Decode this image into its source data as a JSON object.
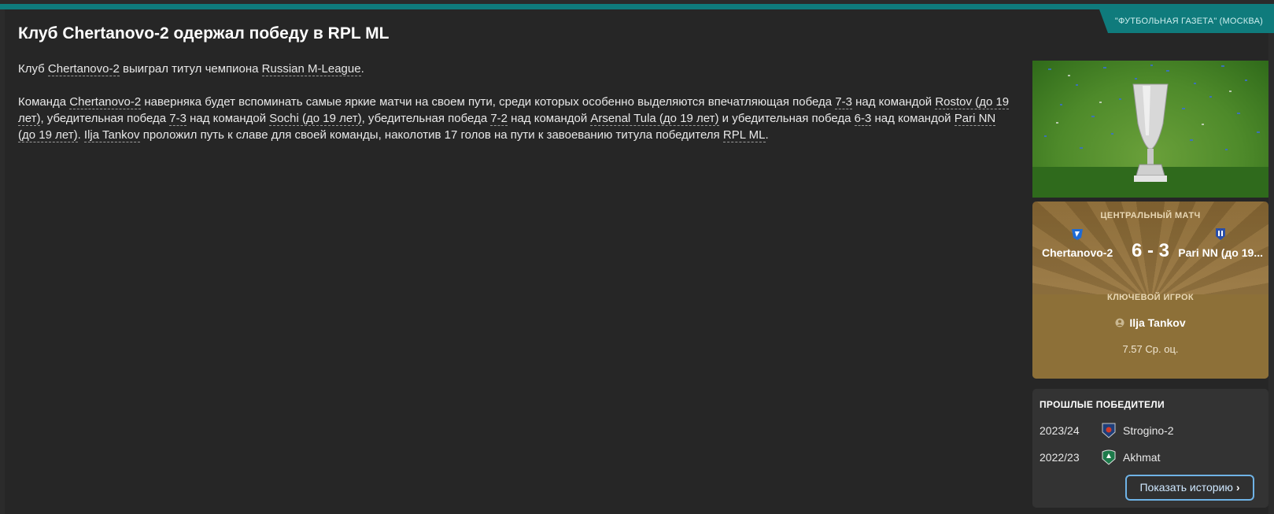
{
  "source": "\"ФУТБОЛЬНАЯ ГАЗЕТА\" (МОСКВА)",
  "headline": "Клуб Chertanovo-2 одержал победу в RPL ML",
  "article": {
    "p1": {
      "t0": "Клуб ",
      "club": "Chertanovo-2",
      "t1": " выиграл титул чемпиона ",
      "league": "Russian M-League",
      "t2": "."
    },
    "p2": {
      "t0": "Команда ",
      "club": "Chertanovo-2",
      "t1": " наверняка будет вспоминать самые яркие матчи на своем пути, среди которых особенно выделяются впечатляющая победа ",
      "score1": "7-3",
      "t2": " над командой ",
      "team1": "Rostov (до 19 лет)",
      "t3": ", убедительная победа ",
      "score2": "7-3",
      "t4": " над командой ",
      "team2": "Sochi (до 19 лет)",
      "t5": ", убедительная победа ",
      "score3": "7-2",
      "t6": " над командой ",
      "team3": "Arsenal Tula (до 19 лет)",
      "t7": " и убедительная победа ",
      "score4": "6-3",
      "t8": " над командой ",
      "team4": "Pari NN (до 19 лет)",
      "t9": ". ",
      "player": "Ilja Tankov",
      "t10": " проложил путь к славе для своей команды, наколотив 17 голов на пути к завоеванию титула победителя ",
      "league": "RPL ML",
      "t11": "."
    }
  },
  "match_card": {
    "label": "ЦЕНТРАЛЬНЫЙ МАТЧ",
    "home_team": "Chertanovo-2",
    "away_team": "Pari NN (до 19...",
    "score": "6 - 3",
    "key_player_label": "КЛЮЧЕВОЙ ИГРОК",
    "key_player": "Ilja Tankov",
    "rating": "7.57 Ср. оц."
  },
  "past_winners": {
    "title": "ПРОШЛЫЕ ПОБЕДИТЕЛИ",
    "rows": [
      {
        "season": "2023/24",
        "team": "Strogino-2"
      },
      {
        "season": "2022/23",
        "team": "Akhmat"
      }
    ],
    "button_label": "Показать историю",
    "button_icon": "chevron-right-icon"
  },
  "colors": {
    "accent": "#0f7b7c",
    "panel": "#262626",
    "match_card": "#8d7038",
    "button_border": "#6fb3e6"
  }
}
